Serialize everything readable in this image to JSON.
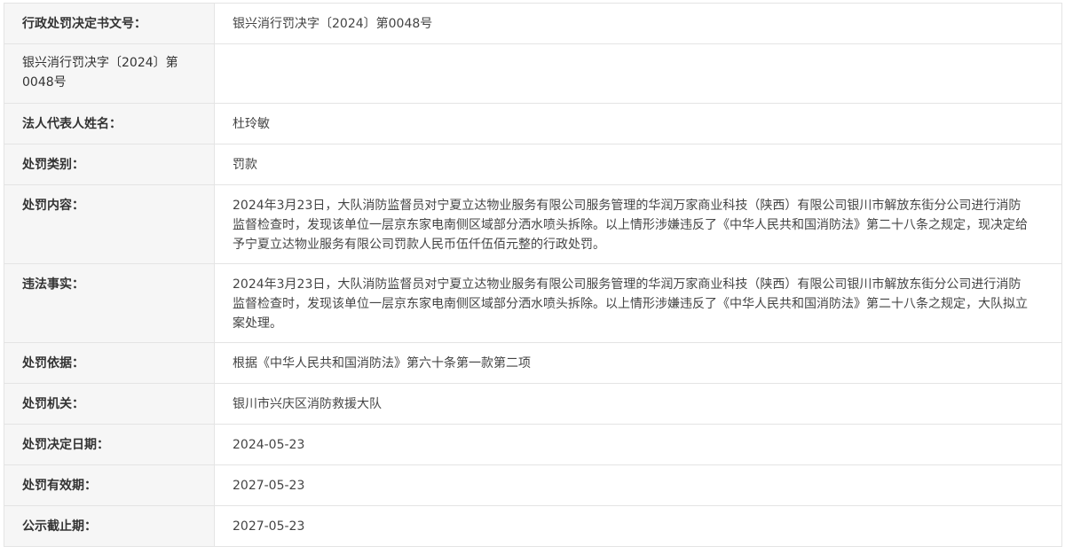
{
  "rows": [
    {
      "label": "行政处罚决定书文号：",
      "value": "银兴消行罚决字〔2024〕第0048号"
    },
    {
      "label": "银兴消行罚决字〔2024〕第0048号",
      "value": ""
    },
    {
      "label": "法人代表人姓名：",
      "value": "杜玲敏"
    },
    {
      "label": "处罚类别：",
      "value": "罚款"
    },
    {
      "label": "处罚内容：",
      "value": "2024年3月23日，大队消防监督员对宁夏立达物业服务有限公司服务管理的华润万家商业科技（陕西）有限公司银川市解放东街分公司进行消防监督检查时，发现该单位一层京东家电南侧区域部分洒水喷头拆除。以上情形涉嫌违反了《中华人民共和国消防法》第二十八条之规定，现决定给予宁夏立达物业服务有限公司罚款人民币伍仟伍佰元整的行政处罚。"
    },
    {
      "label": "违法事实：",
      "value": "2024年3月23日，大队消防监督员对宁夏立达物业服务有限公司服务管理的华润万家商业科技（陕西）有限公司银川市解放东街分公司进行消防监督检查时，发现该单位一层京东家电南侧区域部分洒水喷头拆除。以上情形涉嫌违反了《中华人民共和国消防法》第二十八条之规定，大队拟立案处理。"
    },
    {
      "label": "处罚依据：",
      "value": "根据《中华人民共和国消防法》第六十条第一款第二项"
    },
    {
      "label": "处罚机关：",
      "value": "银川市兴庆区消防救援大队"
    },
    {
      "label": "处罚决定日期：",
      "value": "2024-05-23"
    },
    {
      "label": "处罚有效期：",
      "value": "2027-05-23"
    },
    {
      "label": "公示截止期：",
      "value": "2027-05-23"
    }
  ]
}
